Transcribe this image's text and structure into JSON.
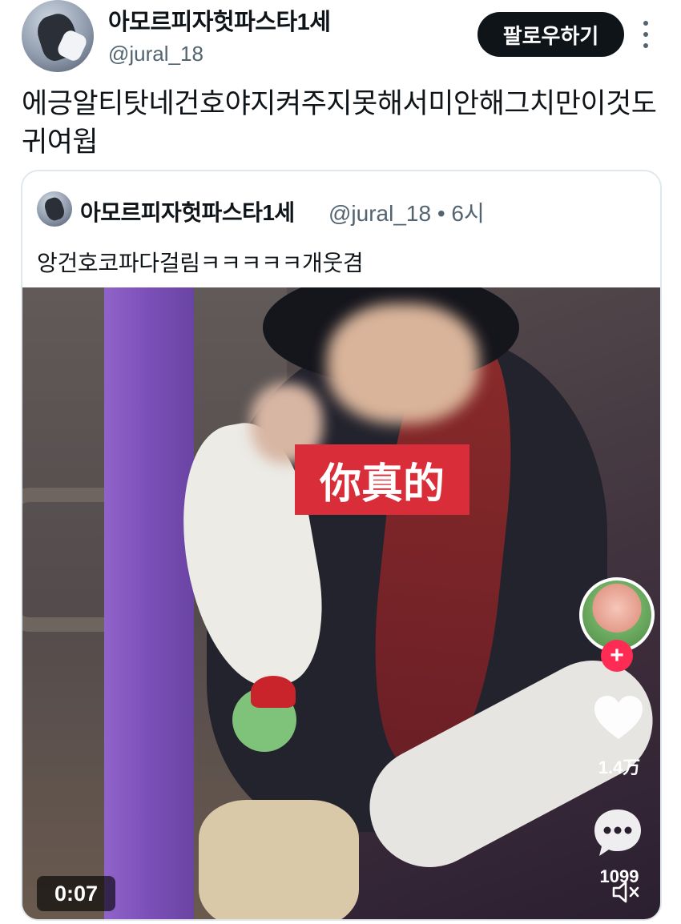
{
  "header": {
    "display_name": "아모르피자헛파스타1세",
    "handle": "@jural_18",
    "follow_label": "팔로우하기",
    "more_icon": "more-vertical-icon"
  },
  "post": {
    "text": "에긍알티탓네건호야지켜주지못해서미안해그치만이것도 귀여웝"
  },
  "quote": {
    "display_name": "아모르피자헛파스타1세",
    "handle_time": "@jural_18 • 6시",
    "text": "앙건호코파다걸림ㅋㅋㅋㅋㅋ개웃겸",
    "video": {
      "caption": "你真的",
      "like_count": "1.4万",
      "comment_count": "1099",
      "duration": "0:07",
      "plus_label": "+",
      "colors": {
        "plus": "#fe2c55",
        "caption_bg": "#d92e39"
      }
    }
  }
}
